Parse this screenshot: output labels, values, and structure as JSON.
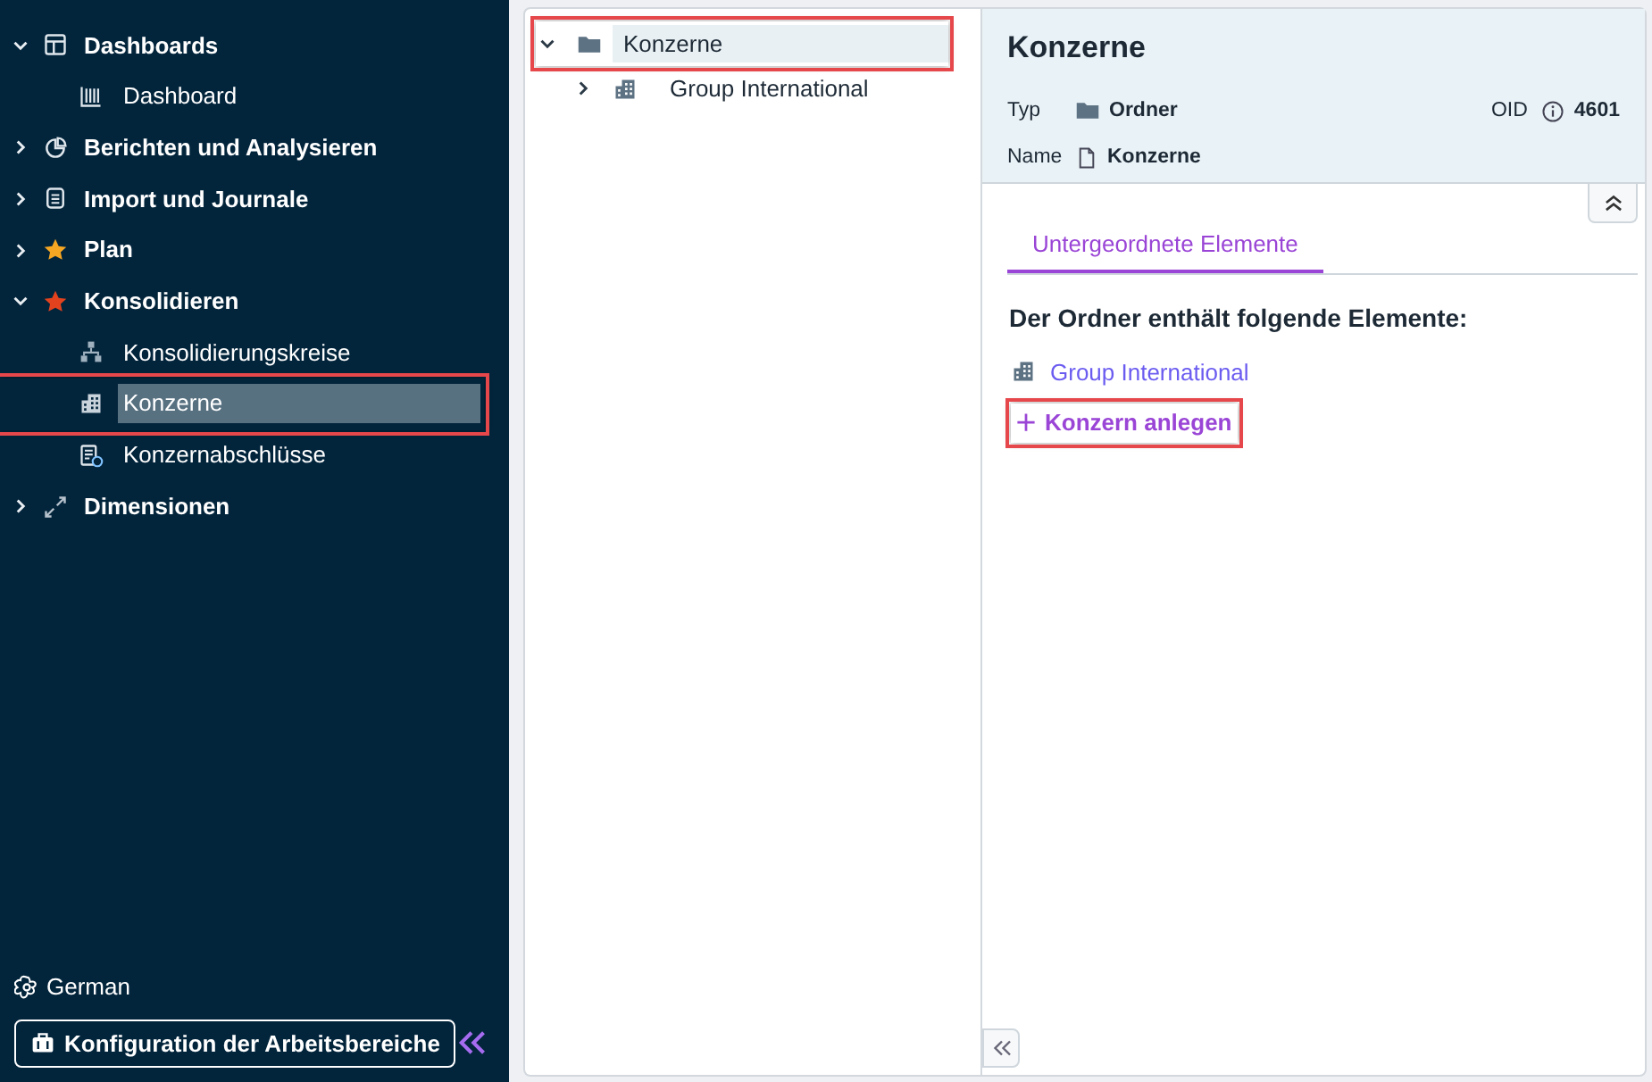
{
  "sidebar": {
    "items": [
      {
        "label": "Dashboards",
        "expanded": true,
        "selected": false,
        "children": [
          {
            "label": "Dashboard",
            "selected": false,
            "highlighted": false
          }
        ]
      },
      {
        "label": "Berichten und Analysieren",
        "expanded": false,
        "selected": false
      },
      {
        "label": "Import und Journale",
        "expanded": false,
        "selected": false
      },
      {
        "label": "Plan",
        "expanded": false,
        "selected": false
      },
      {
        "label": "Konsolidieren",
        "expanded": true,
        "selected": false,
        "children": [
          {
            "label": "Konsolidierungskreise",
            "selected": false,
            "highlighted": false
          },
          {
            "label": "Konzerne",
            "selected": true,
            "highlighted": true
          },
          {
            "label": "Konzernabschlüsse",
            "selected": false,
            "highlighted": false
          }
        ]
      },
      {
        "label": "Dimensionen",
        "expanded": false,
        "selected": false
      }
    ],
    "language": "German",
    "config_button": "Konfiguration der Arbeitsbereiche"
  },
  "tree": {
    "items": [
      {
        "label": "Konzerne",
        "expanded": true,
        "selected": true,
        "highlighted": true,
        "children": [
          {
            "label": "Group International",
            "expanded": false,
            "selected": false,
            "highlighted": false
          }
        ]
      }
    ]
  },
  "detail": {
    "title": "Konzerne",
    "fields": [
      {
        "label": "Typ",
        "value": "Ordner"
      },
      {
        "label": "OID",
        "value": "4601"
      },
      {
        "label": "Name",
        "value": "Konzerne"
      }
    ],
    "tabs": [
      {
        "label": "Untergeordnete Elemente",
        "selected": true
      }
    ],
    "heading": "Der Ordner enthält folgende Elemente:",
    "elements": [
      {
        "label": "Group International"
      }
    ],
    "create_link": {
      "label": "Konzern anlegen",
      "highlighted": true
    }
  }
}
